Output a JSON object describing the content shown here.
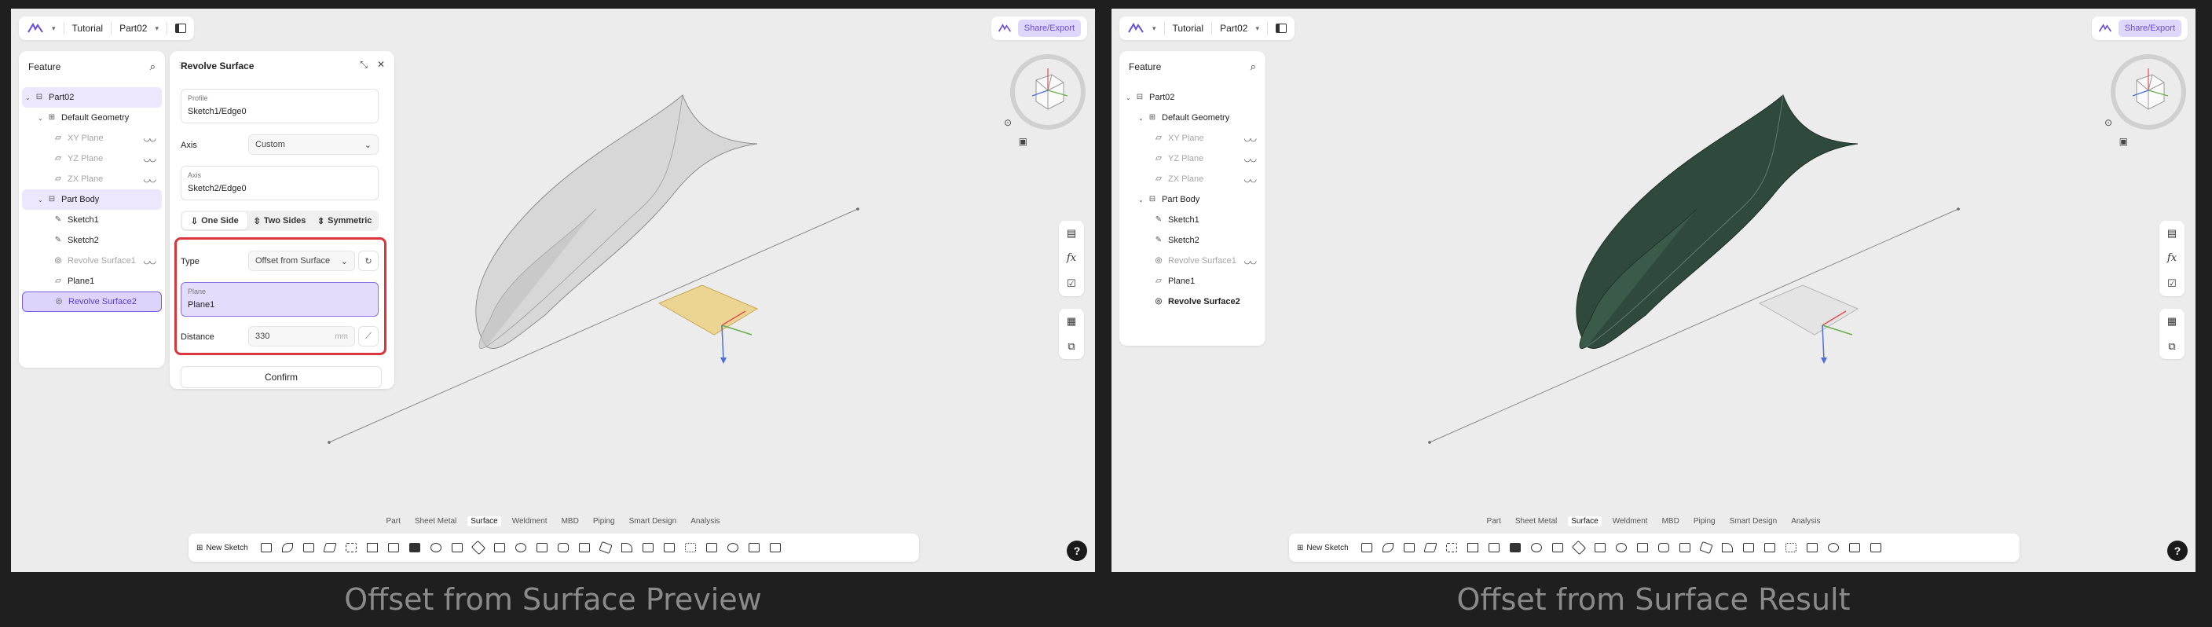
{
  "captions": {
    "left": "Offset from Surface Preview",
    "right": "Offset from Surface Result"
  },
  "topbar": {
    "tutorial": "Tutorial",
    "part": "Part02",
    "share": "Share/Export"
  },
  "tree": {
    "header": "Feature",
    "items": [
      {
        "label": "Part02"
      },
      {
        "label": "Default Geometry"
      },
      {
        "label": "XY Plane"
      },
      {
        "label": "YZ Plane"
      },
      {
        "label": "ZX Plane"
      },
      {
        "label": "Part Body"
      },
      {
        "label": "Sketch1"
      },
      {
        "label": "Sketch2"
      },
      {
        "label": "Revolve Surface1"
      },
      {
        "label": "Plane1"
      },
      {
        "label": "Revolve Surface2"
      }
    ]
  },
  "revolve": {
    "title": "Revolve Surface",
    "profile_label": "Profile",
    "profile_value": "Sketch1/Edge0",
    "axis_label": "Axis",
    "axis_select": "Custom",
    "axis_box_label": "Axis",
    "axis_box_value": "Sketch2/Edge0",
    "tabs": [
      "One Side",
      "Two Sides",
      "Symmetric"
    ],
    "type_label": "Type",
    "type_value": "Offset from Surface",
    "plane_label": "Plane",
    "plane_value": "Plane1",
    "distance_label": "Distance",
    "distance_value": "330",
    "distance_unit": "mm",
    "confirm": "Confirm"
  },
  "bottom_tabs": [
    "Part",
    "Sheet Metal",
    "Surface",
    "Weldment",
    "MBD",
    "Piping",
    "Smart Design",
    "Analysis"
  ],
  "active_tab": "Surface",
  "toolbar": {
    "new_sketch": "New Sketch"
  },
  "help": "?",
  "colors": {
    "accent": "#7a5ce0",
    "highlight_box": "#d9363e",
    "surface_preview": "#c8c8c8",
    "surface_result": "#2f4a3c",
    "plane_preview": "#e9cf8a"
  }
}
